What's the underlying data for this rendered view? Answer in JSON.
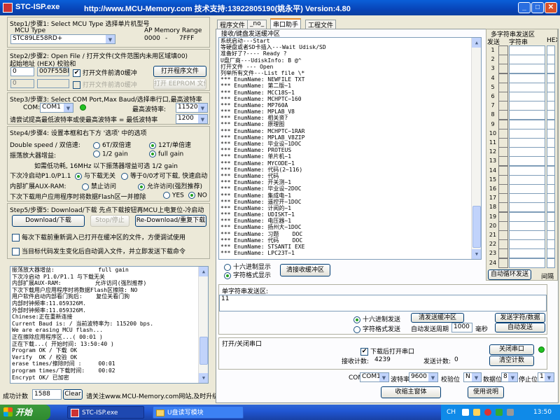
{
  "window": {
    "app_title": "STC-ISP.exe",
    "title_center": "http://www.MCU-Memory.com 技术支持:13922805190(姚永平) Version:4.80"
  },
  "step1": {
    "title": "Step1/步骤1: Select MCU Type  选择单片机型号",
    "mcu_type_label": "MCU Type",
    "ap_memory_label": "AP Memory Range",
    "mcu_type_value": "STC89LE58RD+",
    "range_start": "0000",
    "range_sep": "-",
    "range_end": "7FFF"
  },
  "step2": {
    "title": "Step2/步骤2: Open File / 打开文件(文件范围内未用区域填00)",
    "addr_label": "起始地址 (HEX) 校验和",
    "addr1_value": "0",
    "checksum1_value": "007F55BM",
    "clear_before_open1": "打开文件前清0缓冲",
    "open_program_file": "打开程序文件",
    "addr2_value": "0",
    "checksum2_value": "",
    "clear_before_open2": "打开文件前清0缓冲",
    "open_eeprom_file": "打开 EEPROM 文件"
  },
  "step3": {
    "title": "Step3/步骤3: Select COM Port,Max Baud/选择串行口,最高波特率",
    "com_label": "COM:",
    "com_value": "COM1",
    "max_baud_label": "最高波特率:",
    "max_baud_value": "115200",
    "min_baud_hint": "请尝试提高最低波特率或使最高波特率 = 最低波特率",
    "min_baud_label": "最低波特率:",
    "min_baud_value": "1200"
  },
  "step4": {
    "title": "Step4/步骤4: 设置本框和右下方 '选项' 中的选项",
    "double_speed_label": "Double speed / 双倍速:",
    "opt_6t": "6T/双倍速",
    "opt_12t": "12T/单倍速",
    "amp_label": "振荡放大器增益:",
    "opt_half_gain": "1/2 gain",
    "opt_full_gain": "full gain",
    "amp_note": "如需低功耗, 16MHz 以下振荡器增益可选 1/2 gain",
    "next_cold_label": "下次冷启动P1.0/P1.1",
    "opt_no_relation": "与下载无关",
    "opt_fast_start": "等于0/0才可下载, 快速启动",
    "aux_ram_label": "内部扩展AUX-RAM:",
    "opt_disable": "禁止访问",
    "opt_allow": "允许访问(强烈推荐)",
    "flash_erase_label": "下次下载用户应用程序时将数据Flash区一并擦除",
    "opt_yes": "YES",
    "opt_no": "NO"
  },
  "step5": {
    "title": "Step5/步骤5: Download/下载  先点下载按钮再MCU上电复位-冷启动",
    "download_button": "Download/下载",
    "stop_button": "Stop/停止",
    "redownload_button": "Re-Download/重复下载",
    "reload_each_time": "每次下载前重新调入已打开在缓冲区的文件，方便调试使用",
    "auto_reload_on_change": "当目标代码发生变化后自动调入文件，并立即发送下载命令"
  },
  "log": {
    "lines": [
      "振荡放大器增益:             full gain",
      "下次冷启动 P1.0/P1.1 与下载无关",
      "内部扩展AUX-RAM:          允许访问(强烈推荐)",
      "下次下载用户应用程序时将数据Flash区擦除: NO",
      "用户软件启动内部看门狗后:    复位关看门狗",
      "内部时钟频率:11.059326M.",
      "外部时钟频率:11.059326M.",
      "Chinese:正在重新连接",
      "Current Baud is: / 当前波特率为: 115200 bps.",
      "We are erasing MCU flash...",
      "正在擦除应用程序区...( 00:01 )",
      "正在下载...( 开始时间: 13:50:40 )",
      "Program OK / 下载 OK",
      "Verify  OK / 校验 OK",
      "erase times/擦除时间 :     00:01",
      "program times/下载时间:    00:02",
      "Encrypt OK/ 已加密"
    ]
  },
  "statusbar": {
    "count_label": "成功计数",
    "count_value": "1588",
    "clear_button": "Clear",
    "notice": "请关注www.MCU-Memory.com网站,及时升级"
  },
  "tabs": [
    "程序文件",
    "_no_",
    "串口助手",
    "工程文件"
  ],
  "serial": {
    "recv_title": "接收/键盘发送缓冲区",
    "recv_lines": [
      "系统启动---Start",
      "等硬盘或者SD卡插入---Wait Udisk/SD",
      "准备好了?---- Ready ?",
      "U盘厂商---UdiskInfo: B @^",
      "打开文件 --- Open",
      "列举所有文件---List file \\*",
      "*** EnumName: NEWFILE TXT",
      "*** EnumName: 第二版~1",
      "*** EnumName: MCC18S~1",
      "*** EnumName: MCHPTC~160",
      "*** EnumName: MP760A",
      "*** EnumName: MPLAB_V8",
      "*** EnumName: 相关资?",
      "*** EnumName: 原理图",
      "*** EnumName: MCHPTC~1RAR",
      "*** EnumName: MPLAB_V8ZIP",
      "*** EnumName: 毕业设~1DOC",
      "*** EnumName: PROTEUS",
      "*** EnumName: 单片机~1",
      "*** EnumName: MYCODE~1",
      "*** EnumName: 代码(2~116)",
      "*** EnumName: 代码",
      "*** EnumName: 开关测~1",
      "*** EnumName: 毕业设~2DOC",
      "*** EnumName: 集成电~1",
      "*** EnumName: 遥控开~1DOC",
      "*** EnumName: 计阅的~1",
      "*** EnumName: UDISKT~1",
      "*** EnumName: 电压器~1",
      "*** EnumName: 扬州大~1DOC",
      "*** EnumName: 习题    DOC",
      "*** EnumName: 代码    DOC",
      "*** EnumName: STSANTI EXE",
      "*** EnumName: LPC23T~1"
    ],
    "hex_display": "十六进制显示",
    "char_display": "字符格式显示",
    "clear_recv_button": "清接收缓冲区",
    "send_title": "单字符串发送区:",
    "send_value": "11",
    "send_hex": "十六进制发送",
    "send_char": "字符格式发送",
    "clear_send_button": "清发送缓冲区",
    "send_string_button": "发送字符/数据",
    "auto_period_label": "自动发送周期",
    "auto_period_value": "1000",
    "ms_label": "毫秒",
    "auto_send_button": "自动发送",
    "open_close_title": "打开/关闭串口",
    "open_after_download": "下载后打开串口",
    "close_port_button": "关闭串口",
    "rx_count_label": "接收计数:",
    "rx_count_value": "4239",
    "tx_count_label": "发送计数:",
    "tx_count_value": "0",
    "clear_count_button": "清空计数",
    "com_label": "COM",
    "com_value": "COM1",
    "baud_label": "波特率",
    "baud_value": "9600",
    "parity_label": "校验位",
    "parity_value": "N",
    "databits_label": "数据位",
    "databits_value": "8",
    "stopbits_label": "停止位",
    "stopbits_value": "1",
    "collapse_button": "收缩主窗体",
    "help_button": "使用说明"
  },
  "multistring": {
    "title": "多字符串发送区",
    "col_send": "发送",
    "col_string": "字符串",
    "col_hex": "HEX",
    "row_numbers": [
      "1",
      "2",
      "3",
      "4",
      "5",
      "6",
      "7",
      "8",
      "9",
      "10",
      "11",
      "12",
      "13",
      "14",
      "15",
      "16",
      "17",
      "18",
      "19",
      "20",
      "21",
      "22",
      "23",
      "24"
    ],
    "auto_loop_button": "自动循环发送",
    "interval_label": "间隔"
  },
  "taskbar": {
    "start_label": "开始",
    "task1": "STC-ISP.exe",
    "task2": "U盘读写模块",
    "lang": "CH",
    "clock": "13:50"
  },
  "colors": {
    "title_blue": "#0a5fd8",
    "window_bg": "#ece9d8",
    "taskbar_blue": "#2157d4",
    "start_green": "#3c9a3c",
    "led_green": "#21c121"
  }
}
